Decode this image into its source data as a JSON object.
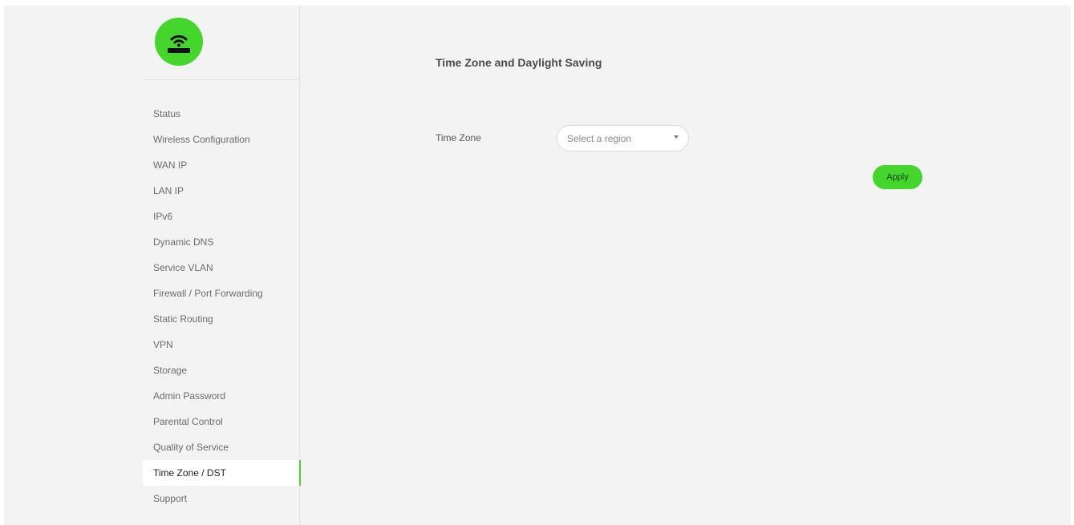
{
  "brand": {
    "logo_icon": "router-wifi-icon",
    "accent_color": "#44d62c"
  },
  "sidebar": {
    "items": [
      {
        "label": "Status"
      },
      {
        "label": "Wireless Configuration"
      },
      {
        "label": "WAN IP"
      },
      {
        "label": "LAN IP"
      },
      {
        "label": "IPv6"
      },
      {
        "label": "Dynamic DNS"
      },
      {
        "label": "Service VLAN"
      },
      {
        "label": "Firewall / Port Forwarding"
      },
      {
        "label": "Static Routing"
      },
      {
        "label": "VPN"
      },
      {
        "label": "Storage"
      },
      {
        "label": "Admin Password"
      },
      {
        "label": "Parental Control"
      },
      {
        "label": "Quality of Service"
      },
      {
        "label": "Time Zone / DST",
        "active": true
      },
      {
        "label": "Support"
      }
    ]
  },
  "main": {
    "title": "Time Zone and Daylight Saving",
    "time_zone": {
      "label": "Time Zone",
      "placeholder": "Select a region",
      "value": ""
    },
    "apply_label": "Apply"
  }
}
